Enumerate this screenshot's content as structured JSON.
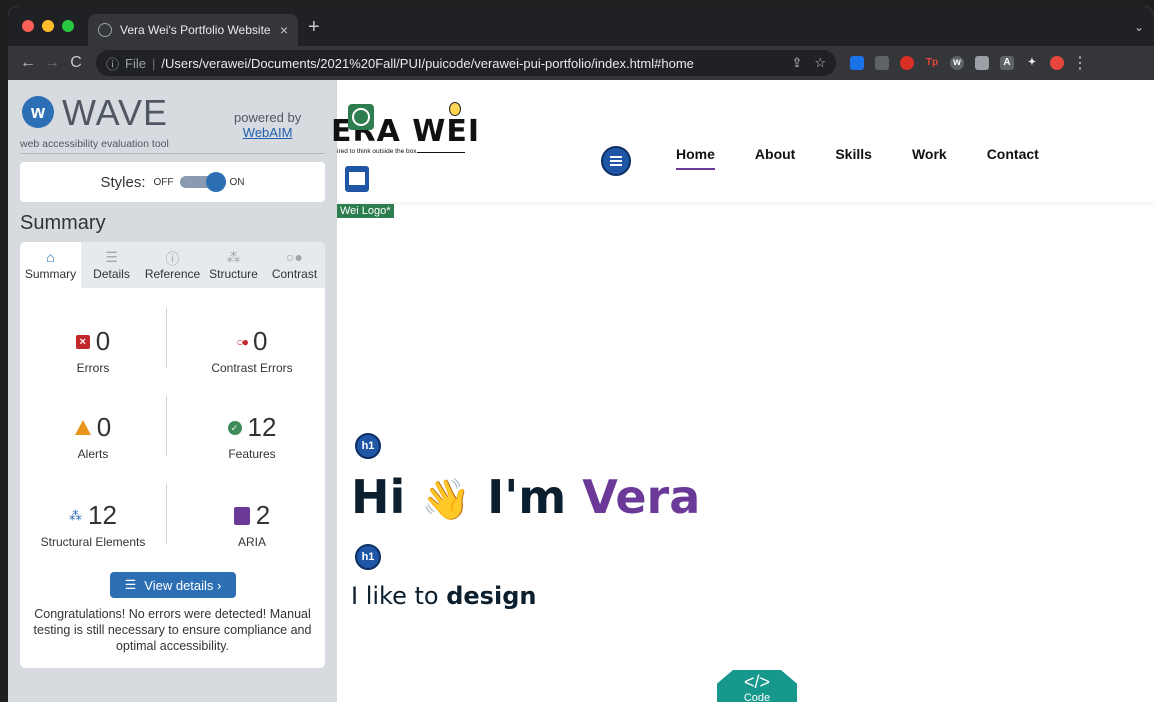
{
  "browser": {
    "tab_title": "Vera Wei's Portfolio Website",
    "tab_close": "×",
    "new_tab": "+",
    "url_scheme": "File",
    "url_path": "/Users/verawei/Documents/2021%20Fall/PUI/puicode/verawei-pui-portfolio/index.html#home"
  },
  "wave": {
    "title": "WAVE",
    "tagline": "web accessibility evaluation tool",
    "powered_by": "powered by",
    "webaim_link": "WebAIM",
    "styles_label": "Styles:",
    "toggle_off": "OFF",
    "toggle_on": "ON",
    "summary_heading": "Summary",
    "tabs": [
      {
        "label": "Summary",
        "icon": "home-icon"
      },
      {
        "label": "Details",
        "icon": "list-icon"
      },
      {
        "label": "Reference",
        "icon": "info-icon"
      },
      {
        "label": "Structure",
        "icon": "structure-icon"
      },
      {
        "label": "Contrast",
        "icon": "contrast-icon"
      }
    ],
    "stats": {
      "errors": {
        "value": "0",
        "label": "Errors"
      },
      "contrast_errors": {
        "value": "0",
        "label": "Contrast Errors"
      },
      "alerts": {
        "value": "0",
        "label": "Alerts"
      },
      "features": {
        "value": "12",
        "label": "Features"
      },
      "structural": {
        "value": "12",
        "label": "Structural Elements"
      },
      "aria": {
        "value": "2",
        "label": "ARIA"
      }
    },
    "view_details": "View details ›",
    "congrats": "Congratulations! No errors were detected! Manual testing is still necessary to ensure compliance and optimal accessibility."
  },
  "site": {
    "logo_text": "ERA WEI",
    "logo_tagline": "ired to think outside the box",
    "logo_alt": "Wei Logo*",
    "nav": [
      "Home",
      "About",
      "Skills",
      "Work",
      "Contact"
    ],
    "h1_badge": "h1",
    "hero_hi": "Hi",
    "hero_wave": "👋",
    "hero_im": "I'm",
    "hero_name": "Vera",
    "subline_pre": "I like to",
    "subline_bold": "design",
    "code_badge_symbol": "</>",
    "code_badge_label": "Code"
  },
  "colors": {
    "accent_purple": "#6b3a98",
    "wave_blue": "#2c6fb5",
    "error_red": "#c3282b",
    "alert_orange": "#e8951c",
    "feature_green": "#3f8b5a"
  }
}
